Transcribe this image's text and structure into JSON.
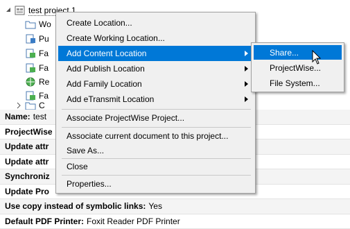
{
  "tree": {
    "root_label": "test project 1",
    "children": [
      "Wo",
      "Pu",
      "Fa",
      "Fa",
      "Re",
      "Fa",
      "C"
    ]
  },
  "properties": [
    {
      "name": "Name:",
      "value": "test"
    },
    {
      "name": "ProjectWise",
      "value": ""
    },
    {
      "name": "Update attr",
      "value": ""
    },
    {
      "name": "Update attr",
      "value": ""
    },
    {
      "name": "Synchroniz",
      "value": ""
    },
    {
      "name": "Update Pro",
      "value": ""
    },
    {
      "name": "Use copy instead of symbolic links:",
      "value": "Yes"
    },
    {
      "name": "Default PDF Printer:",
      "value": "Foxit Reader PDF Printer"
    }
  ],
  "context_menu": {
    "items": [
      {
        "label": "Create Location..."
      },
      {
        "label": "Create Working Location..."
      },
      {
        "label": "Add Content Location"
      },
      {
        "label": "Add Publish Location"
      },
      {
        "label": "Add Family Location"
      },
      {
        "label": "Add eTransmit Location"
      },
      {
        "label": "Associate ProjectWise Project..."
      },
      {
        "label": "Associate current document to this project..."
      },
      {
        "label": "Save As..."
      },
      {
        "label": "Close"
      },
      {
        "label": "Properties..."
      }
    ]
  },
  "submenu": {
    "items": [
      {
        "label": "Share..."
      },
      {
        "label": "ProjectWise..."
      },
      {
        "label": "File System..."
      }
    ]
  },
  "colors": {
    "highlight": "#0078d7",
    "menu_bg": "#f0f0f0"
  }
}
